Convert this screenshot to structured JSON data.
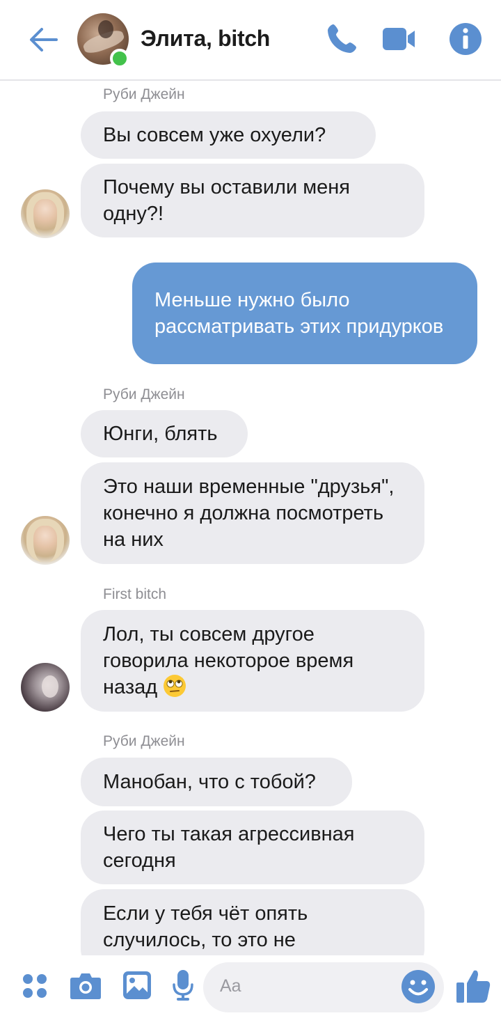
{
  "header": {
    "title": "Элита, bitch",
    "online": true,
    "icons": [
      "back-arrow-icon",
      "phone-icon",
      "video-camera-icon",
      "info-icon"
    ]
  },
  "messages": [
    {
      "sender": "Руби Джейн"
    },
    {
      "text": "Вы совсем уже охуели?"
    },
    {
      "text": "Почему вы оставили меня одну?!"
    },
    {
      "text": "Меньше нужно было рассматривать этих придурков"
    },
    {
      "sender": "Руби Джейн"
    },
    {
      "text": "Юнги, блять"
    },
    {
      "text": "Это наши временные \"друзья\", конечно я должна посмотреть на них"
    },
    {
      "sender": "First bitch"
    },
    {
      "text": "Лол, ты совсем другое говорила некоторое время назад"
    },
    {
      "sender": "Руби Джейн"
    },
    {
      "text": "Манобан, что с тобой?"
    },
    {
      "text": "Чего ты такая агрессивная сегодня"
    },
    {
      "text": "Если у тебя чёт опять случилось, то это не"
    }
  ],
  "composer": {
    "placeholder": "Aa",
    "icons": [
      "apps-icon",
      "camera-icon",
      "gallery-icon",
      "microphone-icon",
      "emoji-icon",
      "thumbs-up-icon"
    ]
  },
  "colors": {
    "accent": "#5b8fd0",
    "outgoing_bubble": "#6699d4",
    "incoming_bubble": "#ebebef",
    "online": "#43c24b"
  }
}
